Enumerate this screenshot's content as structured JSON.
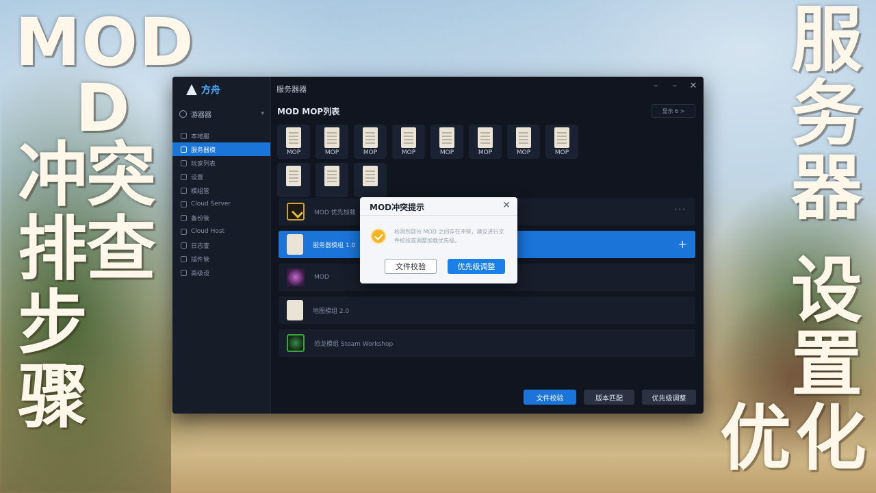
{
  "overlay_text": {
    "left_line1": "MOD",
    "left_line2": "D",
    "left_col1": [
      "冲",
      "排",
      "步",
      "骤"
    ],
    "left_col2": [
      "突",
      "查"
    ],
    "right_col1": [
      "服",
      "务",
      "器"
    ],
    "right_col2": [
      "设",
      "置"
    ],
    "right_bottom": "优化"
  },
  "app": {
    "logo_text": "方舟",
    "window_title": "服务器器",
    "controls": {
      "minimize": "–",
      "maximize": "–",
      "close": "✕"
    }
  },
  "sidebar": {
    "header": "游器器",
    "items": [
      {
        "label": "本地服"
      },
      {
        "label": "服务器模"
      },
      {
        "label": "玩家列表"
      },
      {
        "label": "设置"
      },
      {
        "label": "模组管"
      },
      {
        "label": "Cloud Server"
      },
      {
        "label": "备份管"
      },
      {
        "label": "Cloud Host"
      },
      {
        "label": "日志查"
      },
      {
        "label": "插件管"
      },
      {
        "label": "高级设"
      }
    ],
    "active_index": 1
  },
  "mod_list": {
    "title": "MOD MOP列表",
    "right_control": "显示 6  >",
    "tile_label": "MOP",
    "row1_count": 8,
    "row2_count": 3
  },
  "mod_rows": [
    {
      "name": "MOD 优先加载"
    },
    {
      "name": "服务器模组 1.0"
    },
    {
      "name": "MOD"
    },
    {
      "name": "地图模组 2.0"
    },
    {
      "name": "恐龙模组 Steam Workshop"
    }
  ],
  "footer_buttons": {
    "verify": "文件校验",
    "version": "版本匹配",
    "priority": "优先级调整"
  },
  "dialog": {
    "title": "MOD冲突提示",
    "close": "✕",
    "message": "检测到部分 MOD 之间存在冲突，建议进行文件校验或调整加载优先级。",
    "btn_verify": "文件校验",
    "btn_priority": "优先级调整"
  }
}
